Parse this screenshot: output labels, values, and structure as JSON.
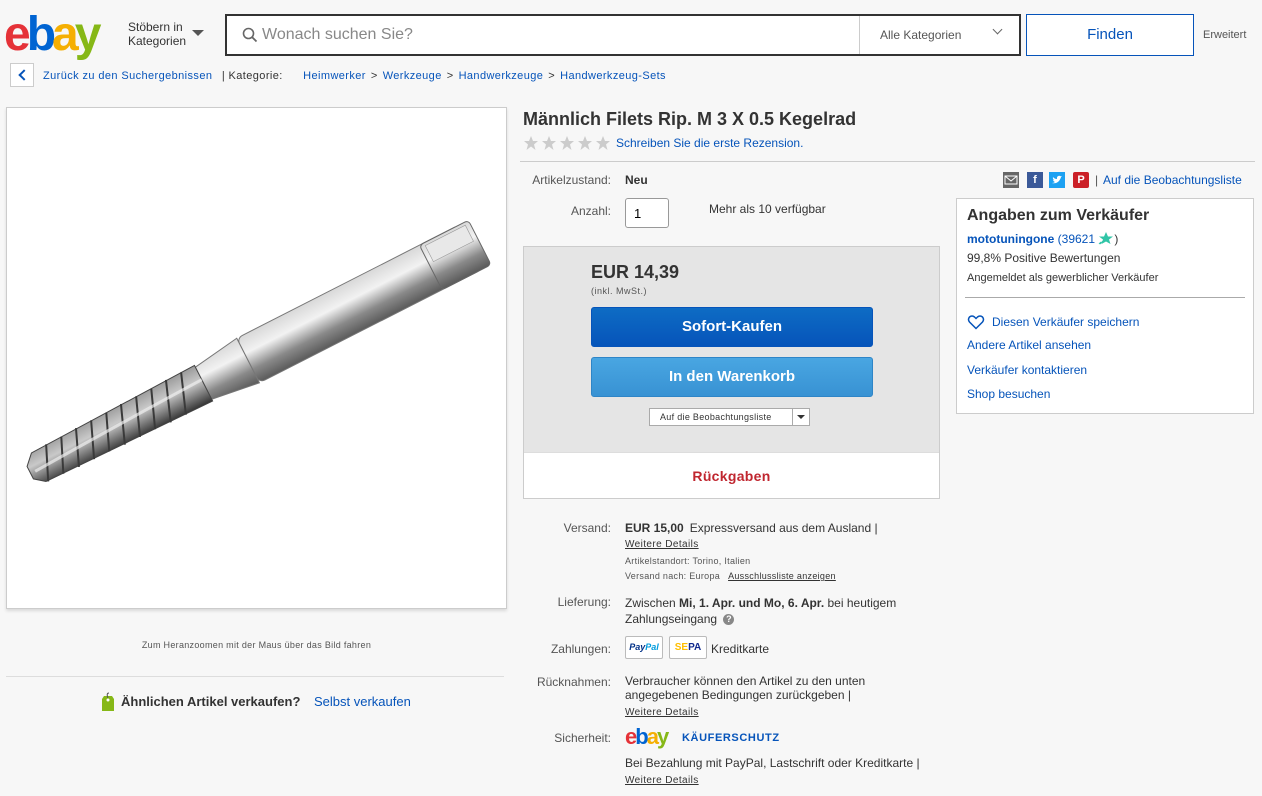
{
  "header": {
    "logo_letters": [
      "e",
      "b",
      "a",
      "y"
    ],
    "browse_line1": "Stöbern in",
    "browse_line2": "Kategorien",
    "search_placeholder": "Wonach suchen Sie?",
    "category": "Alle Kategorien",
    "find_button": "Finden",
    "advanced": "Erweitert"
  },
  "breadcrumb": {
    "back_label": "Zurück zu den Suchergebnissen",
    "category_label": "| Kategorie:",
    "items": [
      "Heimwerker",
      "Werkzeuge",
      "Handwerkzeuge",
      "Handwerkzeug-Sets"
    ],
    "separator": ">"
  },
  "image": {
    "zoom_hint": "Zum Heranzoomen mit der Maus über das Bild fahren"
  },
  "sell": {
    "question": "Ähnlichen Artikel verkaufen?",
    "link": "Selbst verkaufen"
  },
  "item": {
    "title": "Männlich Filets Rip. M 3 X 0.5 Kegelrad",
    "rating_stars": 0,
    "review_link": "Schreiben Sie die erste Rezension.",
    "condition_label": "Artikelzustand:",
    "condition": "Neu",
    "quantity_label": "Anzahl:",
    "quantity": "1",
    "availability": "Mehr als 10 verfügbar"
  },
  "buybox": {
    "price": "EUR 14,39",
    "vat": "(inkl. MwSt.)",
    "buy_now": "Sofort-Kaufen",
    "add_to_cart": "In den Warenkorb",
    "watch_select": "Auf die Beobachtungsliste",
    "returns": "Rückgaben"
  },
  "details": {
    "shipping_label": "Versand:",
    "shipping_price": "EUR 15,00",
    "shipping_text": "Expressversand aus dem Ausland |",
    "shipping_more": "Weitere Details",
    "location": "Artikelstandort: Torino, Italien",
    "ships_to": "Versand nach: Europa",
    "exclusion_link": "Ausschlussliste anzeigen",
    "delivery_label": "Lieferung:",
    "delivery_pre": "Zwischen",
    "delivery_dates": "Mi, 1. Apr. und Mo, 6. Apr.",
    "delivery_post": "bei heutigem Zahlungseingang",
    "payment_label": "Zahlungen:",
    "paypal_a": "Pay",
    "paypal_b": "Pal",
    "sepa_a": "SE",
    "sepa_b": "PA",
    "credit_card": "Kreditkarte",
    "returns_label": "Rücknahmen:",
    "returns_text": "Verbraucher können den Artikel zu den unten angegebenen Bedingungen zurückgeben |",
    "returns_more": "Weitere Details",
    "security_label": "Sicherheit:",
    "buyer_protection": "KÄUFERSCHUTZ",
    "security_text": "Bei Bezahlung mit PayPal, Lastschrift oder Kreditkarte |",
    "security_more": "Weitere Details"
  },
  "share": {
    "icons": [
      "email-icon",
      "facebook-icon",
      "twitter-icon",
      "pinterest-icon"
    ],
    "separator": "|",
    "watch_link": "Auf die Beobachtungsliste"
  },
  "seller": {
    "title": "Angaben zum Verkäufer",
    "name": "mototuningone",
    "feedback_open": "(",
    "feedback": "39621",
    "feedback_close": ")",
    "positive": "99,8% Positive Bewertungen",
    "registered": "Angemeldet als gewerblicher Verkäufer",
    "save": "Diesen Verkäufer speichern",
    "other_items": "Andere Artikel ansehen",
    "contact": "Verkäufer kontaktieren",
    "shop": "Shop besuchen"
  },
  "colors": {
    "link": "#0654ba",
    "buy_now": "#0654ba",
    "add_cart": "#3892d3",
    "returns": "#c0262f"
  }
}
